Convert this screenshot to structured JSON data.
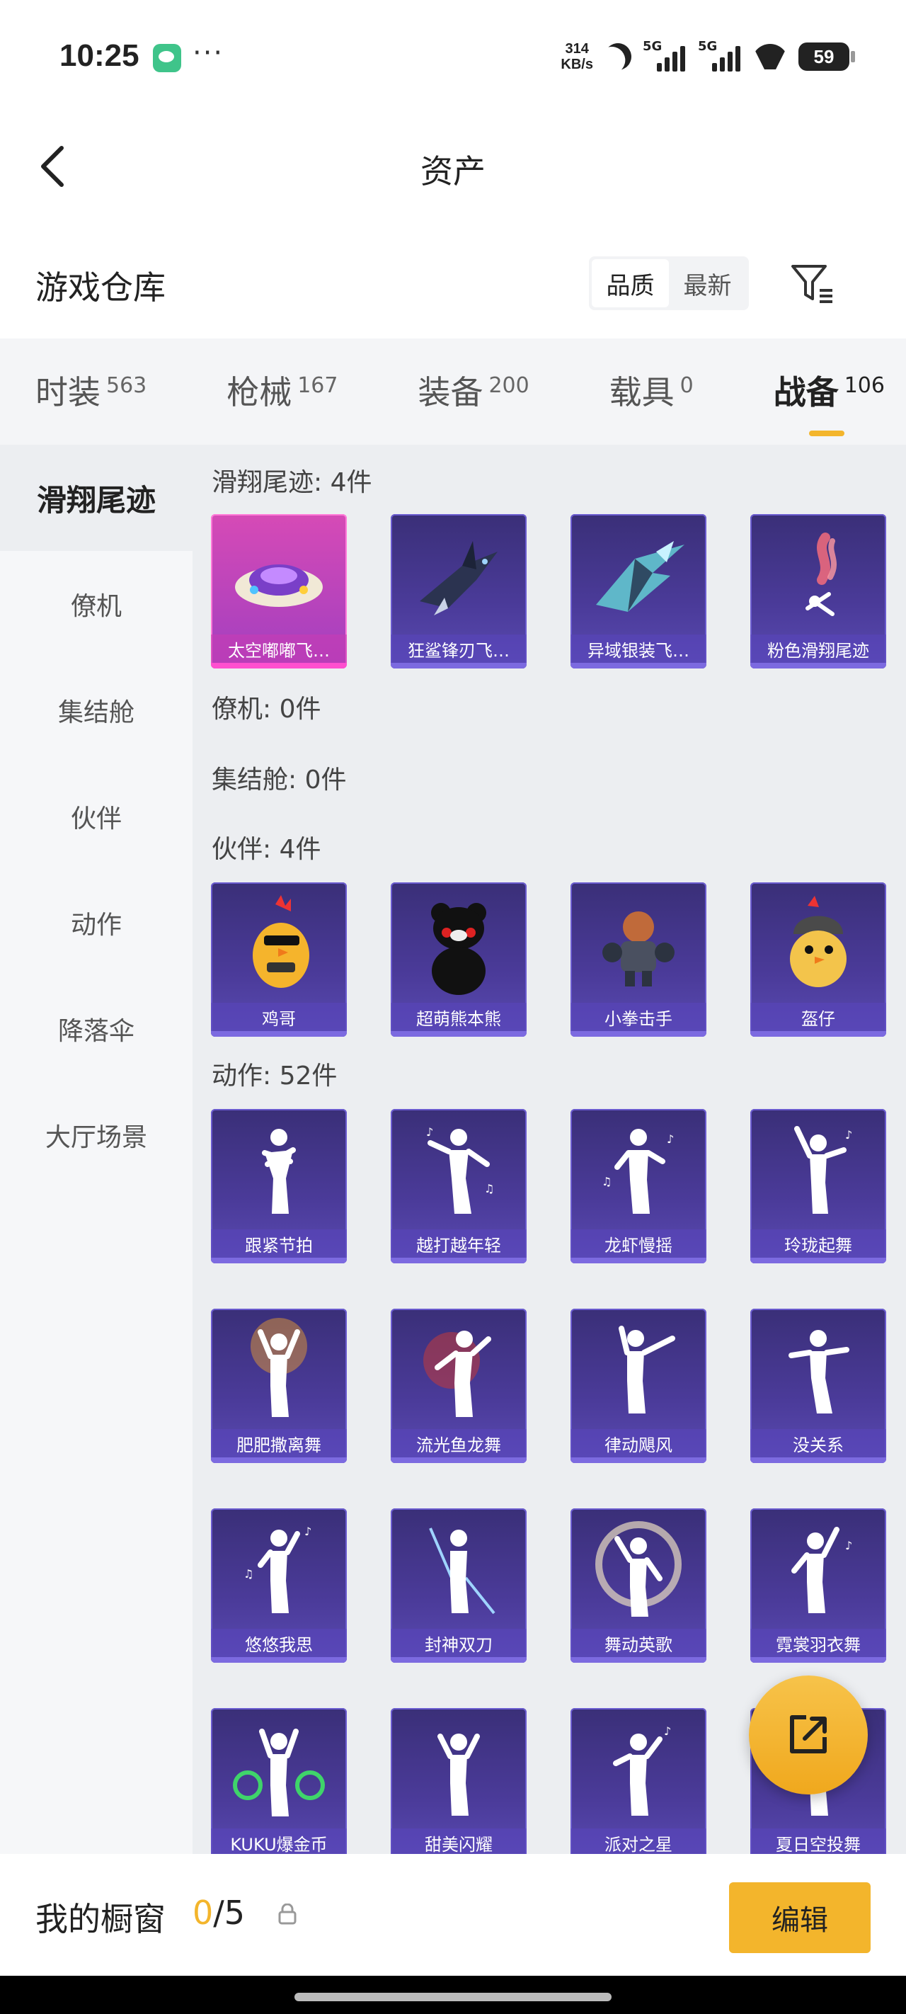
{
  "status_bar": {
    "time": "10:25",
    "speed_value": "314",
    "speed_unit": "KB/s",
    "sig1": "5G",
    "sig2": "5G",
    "battery": "59"
  },
  "nav": {
    "title": "资产"
  },
  "warehouse": {
    "title": "游戏仓库",
    "sort_quality": "品质",
    "sort_newest": "最新"
  },
  "tabs": [
    {
      "label": "时装",
      "count": "563"
    },
    {
      "label": "枪械",
      "count": "167"
    },
    {
      "label": "装备",
      "count": "200"
    },
    {
      "label": "载具",
      "count": "0"
    },
    {
      "label": "战备",
      "count": "106"
    }
  ],
  "sidebar": [
    "滑翔尾迹",
    "僚机",
    "集结舱",
    "伙伴",
    "动作",
    "降落伞",
    "大厅场景"
  ],
  "sections": {
    "glide": {
      "title": "滑翔尾迹: 4件",
      "items": [
        "太空嘟嘟飞…",
        "狂鲨锋刃飞…",
        "异域银装飞…",
        "粉色滑翔尾迹"
      ]
    },
    "wingman": {
      "title": "僚机: 0件"
    },
    "rally": {
      "title": "集结舱: 0件"
    },
    "partner": {
      "title": "伙伴: 4件",
      "items": [
        "鸡哥",
        "超萌熊本熊",
        "小拳击手",
        "盔仔"
      ]
    },
    "emote": {
      "title": "动作: 52件",
      "items": [
        "跟紧节拍",
        "越打越年轻",
        "龙虾慢摇",
        "玲珑起舞",
        "肥肥撒离舞",
        "流光鱼龙舞",
        "律动飓风",
        "没关系",
        "悠悠我思",
        "封神双刀",
        "舞动英歌",
        "霓裳羽衣舞",
        "KUKU爆金币",
        "甜美闪耀",
        "派对之星",
        "夏日空投舞"
      ]
    }
  },
  "bottom": {
    "label": "我的橱窗",
    "count_current": "0",
    "count_total": "/5",
    "edit": "编辑"
  },
  "colors": {
    "accent": "#f3b52c",
    "card": "#4b3b9a",
    "card_rare": "#d64ab6"
  }
}
